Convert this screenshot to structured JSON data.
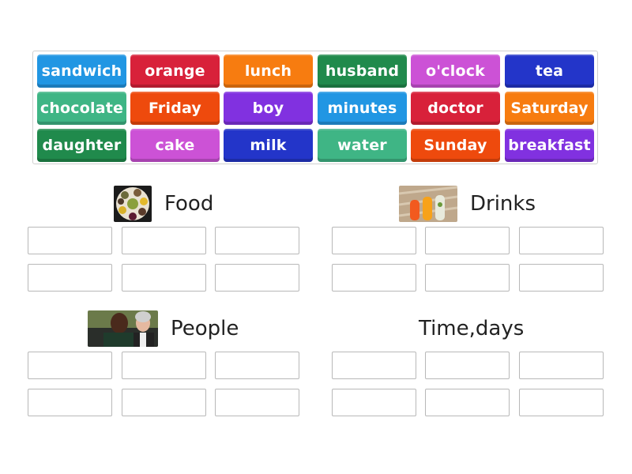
{
  "tiles": [
    {
      "label": "sandwich",
      "color": "#2196e3"
    },
    {
      "label": "orange",
      "color": "#d8213a"
    },
    {
      "label": "lunch",
      "color": "#f77c10"
    },
    {
      "label": "husband",
      "color": "#208a4c"
    },
    {
      "label": "o'clock",
      "color": "#cc52d6"
    },
    {
      "label": "tea",
      "color": "#2335c9"
    },
    {
      "label": "chocolate",
      "color": "#3fb585"
    },
    {
      "label": "Friday",
      "color": "#ee4a0d"
    },
    {
      "label": "boy",
      "color": "#8131e0"
    },
    {
      "label": "minutes",
      "color": "#2196e3"
    },
    {
      "label": "doctor",
      "color": "#d8213a"
    },
    {
      "label": "Saturday",
      "color": "#f77c10"
    },
    {
      "label": "daughter",
      "color": "#208a4c"
    },
    {
      "label": "cake",
      "color": "#cc52d6"
    },
    {
      "label": "milk",
      "color": "#2335c9"
    },
    {
      "label": "water",
      "color": "#3fb585"
    },
    {
      "label": "Sunday",
      "color": "#ee4a0d"
    },
    {
      "label": "breakfast",
      "color": "#8131e0"
    }
  ],
  "groups": [
    {
      "title": "Food",
      "image": "food-platter-image"
    },
    {
      "title": "Drinks",
      "image": "drinks-glasses-image"
    },
    {
      "title": "People",
      "image": "people-laughing-image"
    },
    {
      "title": "Time,days",
      "image": null
    }
  ]
}
